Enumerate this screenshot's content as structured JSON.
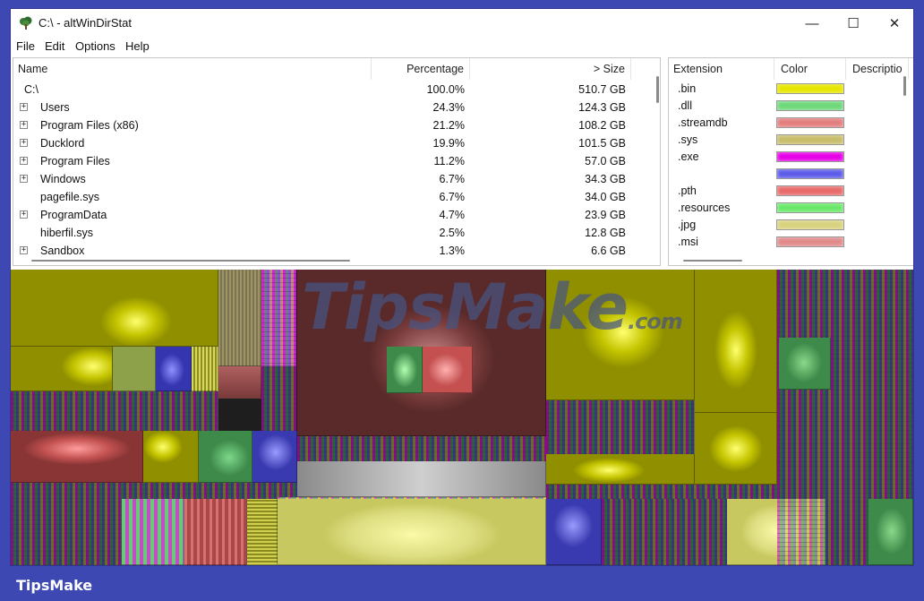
{
  "window": {
    "title": "C:\\ - altWinDirStat",
    "controls": {
      "minimize": "—",
      "maximize": "☐",
      "close": "✕"
    }
  },
  "menu": [
    "File",
    "Edit",
    "Options",
    "Help"
  ],
  "tree": {
    "columns": {
      "name": "Name",
      "percentage": "Percentage",
      "size": "> Size"
    },
    "rows": [
      {
        "name": "C:\\",
        "percentage": "100.0%",
        "size": "510.7 GB",
        "expandable": false,
        "expand_glyph": ""
      },
      {
        "name": "Users",
        "percentage": "24.3%",
        "size": "124.3 GB",
        "expandable": true,
        "expand_glyph": "+"
      },
      {
        "name": "Program Files (x86)",
        "percentage": "21.2%",
        "size": "108.2 GB",
        "expandable": true,
        "expand_glyph": "+"
      },
      {
        "name": "Ducklord",
        "percentage": "19.9%",
        "size": "101.5 GB",
        "expandable": true,
        "expand_glyph": "+"
      },
      {
        "name": "Program Files",
        "percentage": "11.2%",
        "size": "57.0 GB",
        "expandable": true,
        "expand_glyph": "+"
      },
      {
        "name": "Windows",
        "percentage": "6.7%",
        "size": "34.3 GB",
        "expandable": true,
        "expand_glyph": "+"
      },
      {
        "name": "pagefile.sys",
        "percentage": "6.7%",
        "size": "34.0 GB",
        "expandable": false,
        "expand_glyph": ""
      },
      {
        "name": "ProgramData",
        "percentage": "4.7%",
        "size": "23.9 GB",
        "expandable": true,
        "expand_glyph": "+"
      },
      {
        "name": "hiberfil.sys",
        "percentage": "2.5%",
        "size": "12.8 GB",
        "expandable": false,
        "expand_glyph": ""
      },
      {
        "name": "Sandbox",
        "percentage": "1.3%",
        "size": "6.6 GB",
        "expandable": true,
        "expand_glyph": "+"
      }
    ]
  },
  "extensions": {
    "columns": {
      "extension": "Extension",
      "color": "Color",
      "description": "Descriptio"
    },
    "rows": [
      {
        "ext": ".bin",
        "color": "#e6e600"
      },
      {
        "ext": ".dll",
        "color": "#6ed87a"
      },
      {
        "ext": ".streamdb",
        "color": "#e37e7e"
      },
      {
        "ext": ".sys",
        "color": "#c8bd6a"
      },
      {
        "ext": ".exe",
        "color": "#e600e6"
      },
      {
        "ext": "",
        "color": "#5c5ce8"
      },
      {
        "ext": ".pth",
        "color": "#e86a6a"
      },
      {
        "ext": ".resources",
        "color": "#6ae86a"
      },
      {
        "ext": ".jpg",
        "color": "#d8d27e"
      },
      {
        "ext": ".msi",
        "color": "#e08a8a"
      }
    ]
  },
  "watermark": {
    "brand": "TipsMake",
    "suffix": ".com"
  },
  "footer": {
    "brand": "TipsMake"
  }
}
